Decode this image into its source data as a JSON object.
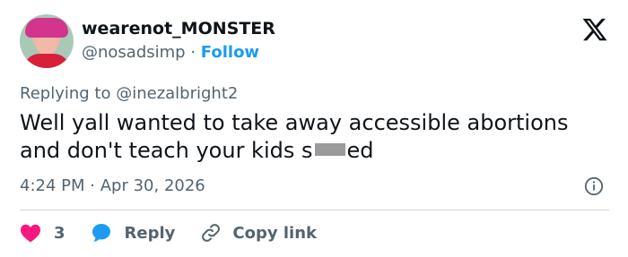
{
  "tweet": {
    "display_name": "wearenot_MONSTER",
    "handle": "@nosadsimp",
    "separator": "·",
    "follow_label": "Follow",
    "replying_prefix": "Replying to",
    "replying_to": "@inezalbright2",
    "text_line1": "Well yall wanted to take away accessible abortions",
    "text_line2_pre": "and don't teach your kids s",
    "text_line2_post": "ed",
    "time": "4:24 PM",
    "date": "Apr 30, 2026",
    "actions": {
      "like_count": "3",
      "reply_label": "Reply",
      "copy_label": "Copy link"
    }
  },
  "colors": {
    "accent": "#1d9bf0",
    "like": "#f91880",
    "muted": "#536471",
    "text": "#0f1419"
  },
  "icons": [
    "x-logo-icon",
    "info-icon",
    "heart-icon",
    "reply-bubble-icon",
    "link-icon"
  ]
}
